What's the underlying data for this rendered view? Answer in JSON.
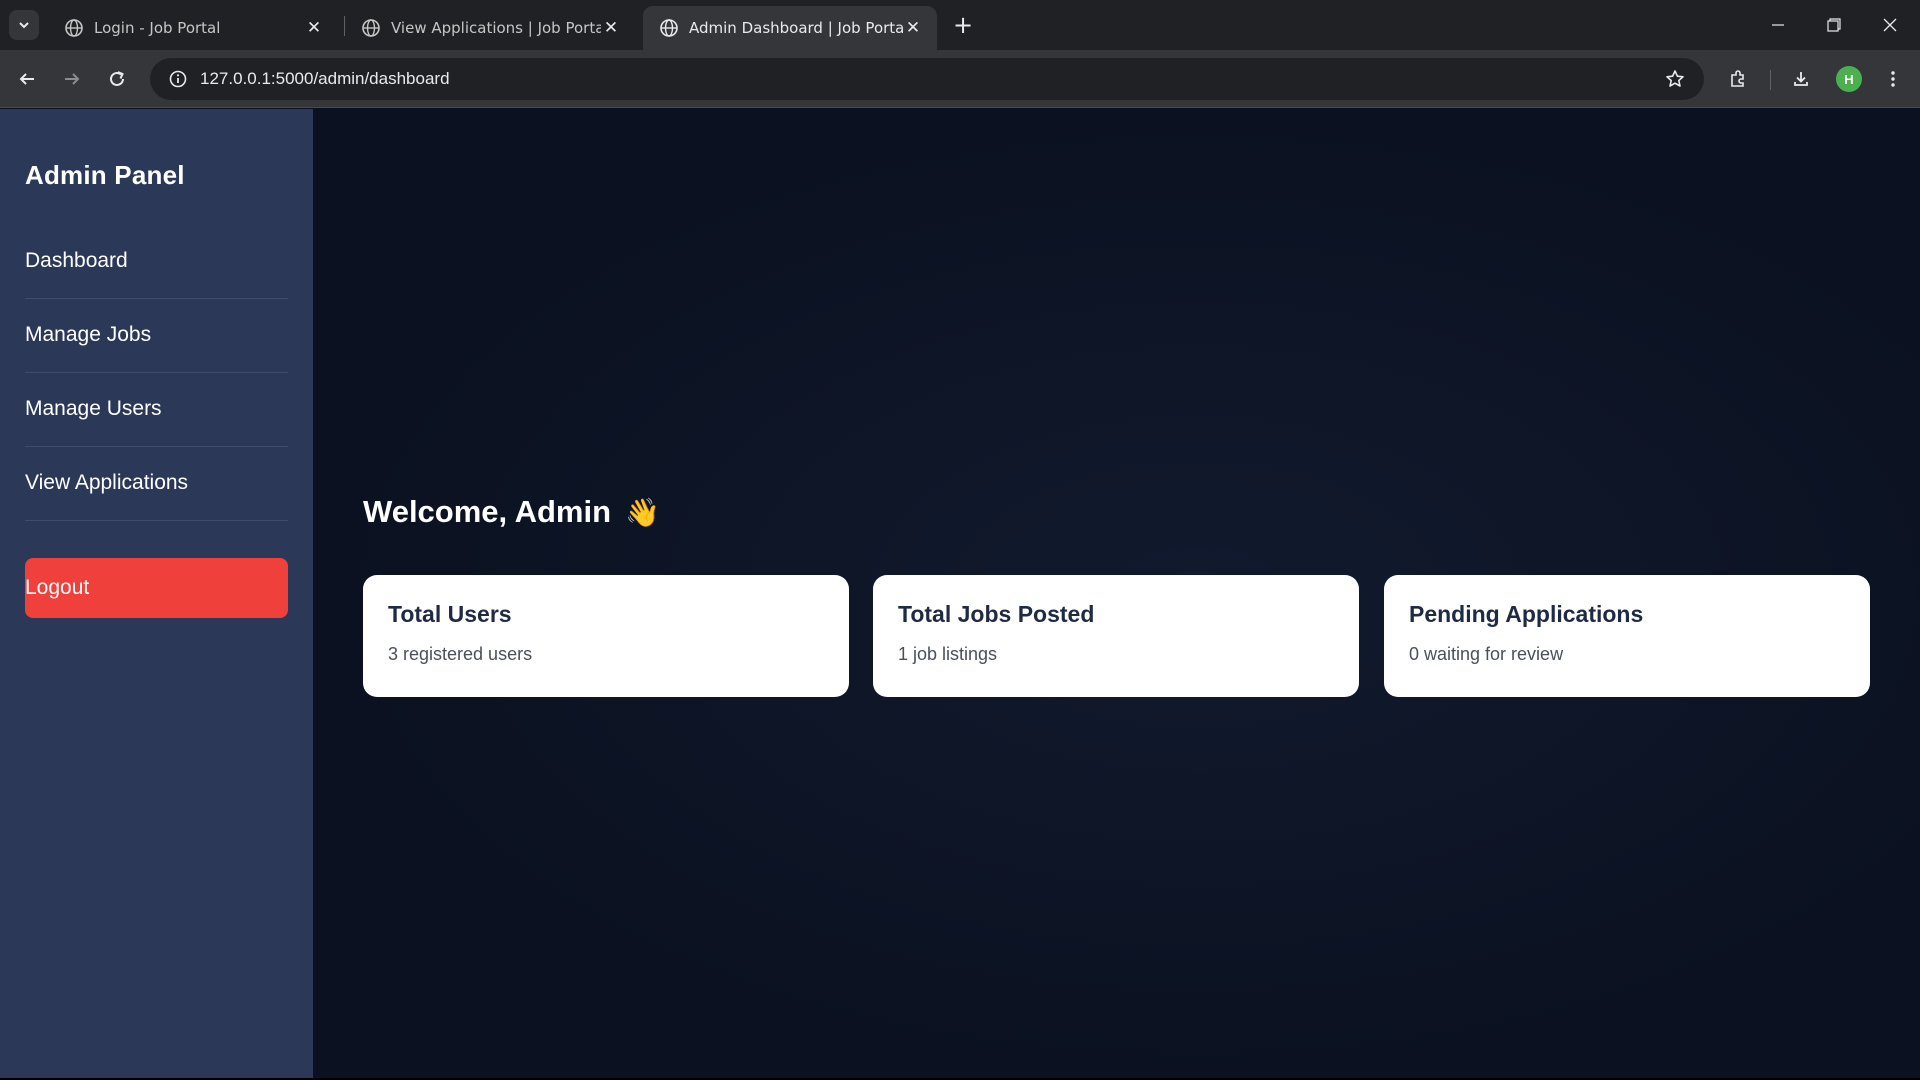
{
  "browser": {
    "tabs": [
      {
        "title": "Login - Job Portal",
        "active": false
      },
      {
        "title": "View Applications | Job Portal",
        "active": false
      },
      {
        "title": "Admin Dashboard | Job Portal",
        "active": true
      }
    ],
    "url": "127.0.0.1:5000/admin/dashboard",
    "profile_initial": "H",
    "profile_color": "#4caf50"
  },
  "sidebar": {
    "brand": "Admin Panel",
    "items": [
      {
        "label": "Dashboard"
      },
      {
        "label": "Manage Jobs"
      },
      {
        "label": "Manage Users"
      },
      {
        "label": "View Applications"
      }
    ],
    "logout_label": "Logout",
    "logout_color": "#f0403b",
    "background": "#2b3857"
  },
  "main": {
    "welcome": "Welcome, Admin",
    "welcome_emoji": "👋",
    "cards": [
      {
        "title": "Total Users",
        "value": "3 registered users"
      },
      {
        "title": "Total Jobs Posted",
        "value": "1 job listings"
      },
      {
        "title": "Pending Applications",
        "value": "0 waiting for review"
      }
    ],
    "background": "#0b1120"
  }
}
